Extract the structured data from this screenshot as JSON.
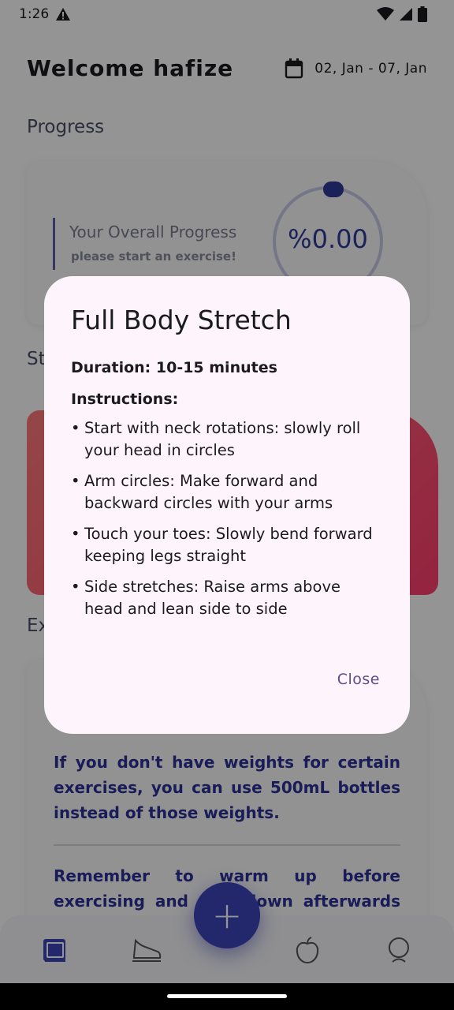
{
  "status": {
    "time": "1:26"
  },
  "header": {
    "welcome": "Welcome hafize",
    "date_range": "02, Jan - 07, Jan"
  },
  "progress": {
    "section_title": "Progress",
    "label": "Your Overall Progress",
    "subtitle": "please start an exercise!",
    "value_text": "%0.00",
    "value": 0.0
  },
  "sections": {
    "second_partial": "St",
    "third_partial": "Ex"
  },
  "tips": [
    "If you don't have weights for certain exercises, you can use 500mL bottles instead of those weights.",
    "Remember to warm up before exercising and cool down afterwards to prevent injuries."
  ],
  "dialog": {
    "title": "Full Body Stretch",
    "duration": "Duration: 10-15 minutes",
    "instructions_label": "Instructions:",
    "instructions": [
      "Start with neck rotations: slowly roll your head in circles",
      "Arm circles: Make forward and backward circles with your arms",
      "Touch your toes: Slowly bend forward keeping legs straight",
      "Side stretches: Raise arms above head and lean side to side"
    ],
    "close_label": "Close"
  },
  "fab": {
    "label": "+"
  },
  "nav": {
    "items": [
      "home-icon",
      "shoe-icon",
      "add",
      "apple-icon",
      "chat-icon"
    ],
    "active_color": "#3d44b8"
  }
}
